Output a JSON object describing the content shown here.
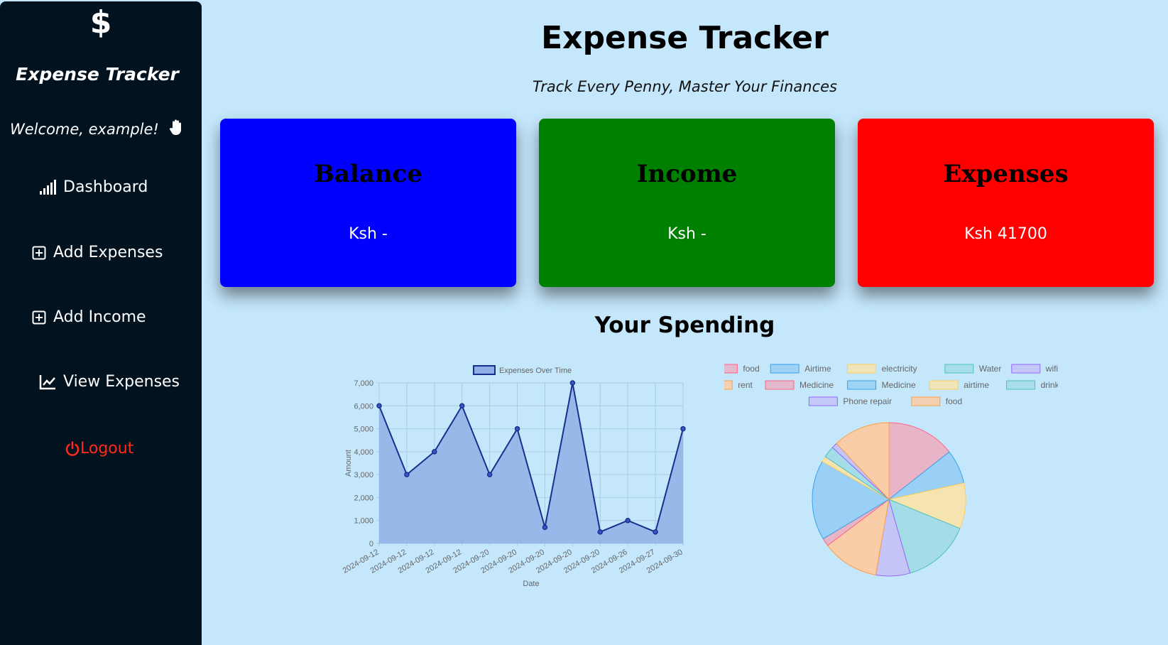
{
  "sidebar": {
    "logo_symbol": "$",
    "app_name": "Expense Tracker",
    "welcome": "Welcome, example!",
    "items": [
      {
        "label": "Dashboard",
        "icon": "signal-bars-icon"
      },
      {
        "label": "Add Expenses",
        "icon": "plus-square-icon"
      },
      {
        "label": "Add Income",
        "icon": "plus-square-icon"
      },
      {
        "label": "View Expenses",
        "icon": "line-chart-icon"
      }
    ],
    "logout_label": "Logout"
  },
  "header": {
    "title": "Expense Tracker",
    "subtitle": "Track Every Penny, Master Your Finances"
  },
  "cards": [
    {
      "title": "Balance",
      "value": "Ksh -",
      "color": "#0000ff"
    },
    {
      "title": "Income",
      "value": "Ksh -",
      "color": "#008000"
    },
    {
      "title": "Expenses",
      "value": "Ksh 41700",
      "color": "#ff0000"
    }
  ],
  "spending_title": "Your Spending",
  "chart_data": [
    {
      "type": "area",
      "legend": [
        "Expenses Over Time"
      ],
      "x": [
        "2024-09-12",
        "2024-09-12",
        "2024-09-12",
        "2024-09-12",
        "2024-09-20",
        "2024-09-20",
        "2024-09-20",
        "2024-09-20",
        "2024-09-20",
        "2024-09-26",
        "2024-09-27",
        "2024-09-30"
      ],
      "values": [
        6000,
        3000,
        4000,
        6000,
        3000,
        5000,
        700,
        7000,
        500,
        1000,
        500,
        5000
      ],
      "xlabel": "Date",
      "ylabel": "Amount",
      "ylim": [
        0,
        7000
      ],
      "yticks": [
        "0",
        "1,000",
        "2,000",
        "3,000",
        "4,000",
        "5,000",
        "6,000",
        "7,000"
      ],
      "grid": true,
      "legend_position": "top",
      "line_color": "#1a2f8c",
      "fill_color": "#8fb0e6"
    },
    {
      "type": "pie",
      "labels": [
        "food",
        "Airtime",
        "electricity",
        "Water",
        "wifi",
        "rent",
        "Medicine",
        "Medicine",
        "airtime",
        "drinks",
        "Phone repair",
        "food"
      ],
      "values": [
        6000,
        3000,
        4000,
        6000,
        3000,
        5000,
        700,
        7000,
        500,
        1000,
        500,
        5000
      ],
      "colors": [
        "#e8b4c8",
        "#9ad0f5",
        "#f5e4b0",
        "#a4dde8",
        "#c4c4f7",
        "#f8cda8",
        "#e8b4c8",
        "#9ad0f5",
        "#f5e4b0",
        "#a4dde8",
        "#c4c4f7",
        "#f8cda8"
      ],
      "borders": [
        "#ff6384",
        "#36a2eb",
        "#ffce56",
        "#4bc0c0",
        "#9966ff",
        "#ff9f40",
        "#ff6384",
        "#36a2eb",
        "#ffce56",
        "#4bc0c0",
        "#9966ff",
        "#ff9f40"
      ],
      "legend_position": "top"
    }
  ]
}
